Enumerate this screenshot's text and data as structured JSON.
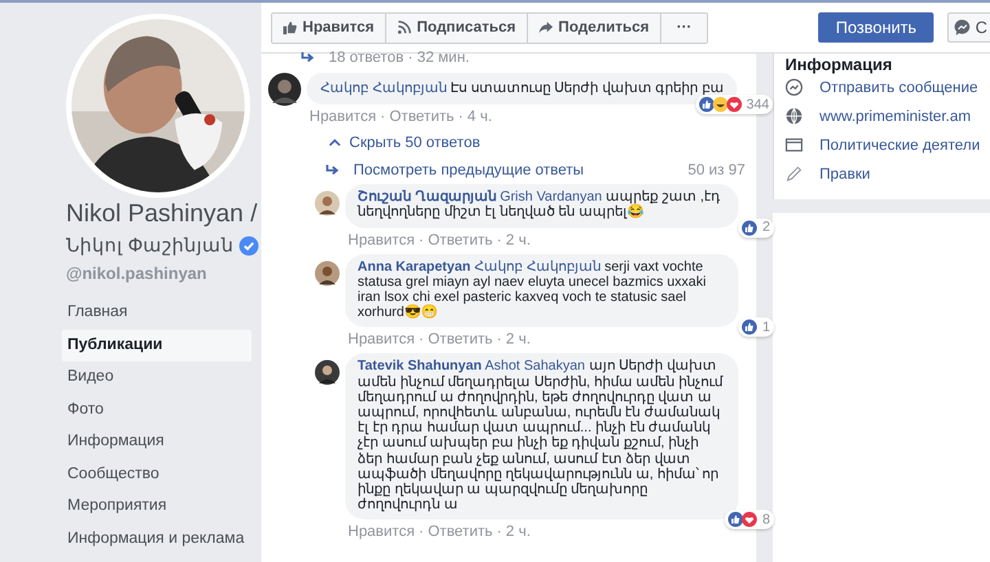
{
  "profile": {
    "name_line1": "Nikol Pashinyan /",
    "name_line2": "Նիկոլ Փաշինյան",
    "verified": true,
    "handle": "@nikol.pashinyan"
  },
  "nav": [
    {
      "label": "Главная",
      "selected": false
    },
    {
      "label": "Публикации",
      "selected": true
    },
    {
      "label": "Видео",
      "selected": false
    },
    {
      "label": "Фото",
      "selected": false
    },
    {
      "label": "Информация",
      "selected": false
    },
    {
      "label": "Сообщество",
      "selected": false
    },
    {
      "label": "Мероприятия",
      "selected": false
    },
    {
      "label": "Информация и реклама",
      "selected": false
    }
  ],
  "page_actions": [
    {
      "kind": "like",
      "label": "Нравится"
    },
    {
      "kind": "follow",
      "label": "Подписаться"
    },
    {
      "kind": "share",
      "label": "Поделиться"
    },
    {
      "kind": "more",
      "label": "···"
    }
  ],
  "call_button": "Позвонить",
  "message_button": "С",
  "thread": {
    "replies_summary": "18 ответов · 32 мин.",
    "comment": {
      "author": "Հակոբ Հակոբյան",
      "text": "Էս ստատուսը Սերժի վախտ գրեիր բա",
      "reactions": [
        {
          "kind": "like"
        },
        {
          "kind": "haha"
        },
        {
          "kind": "love"
        }
      ],
      "reaction_count": "344",
      "like": "Нравится",
      "separator": "·",
      "reply": "Ответить",
      "time": "4 ч."
    },
    "hide_replies": "Скрыть 50 ответов",
    "previous_replies": "Посмотреть предыдущие ответы",
    "shown_count": "50 из 97",
    "replies": [
      {
        "author": "Շուշան Ղազարյան",
        "tag": "Grish Vardanyan",
        "text": "ապրեք շատ ,էդ նեղվողները միշտ էլ նեղված են ապրել😂",
        "reactions": [
          {
            "kind": "like"
          }
        ],
        "reaction_count": "2",
        "like": "Нравится",
        "separator": "·",
        "reply": "Ответить",
        "time": "2 ч."
      },
      {
        "author": "Anna Karapetyan",
        "tag": "Հակոբ Հակոբյան",
        "text": "serji vaxt vochte statusa grel miayn ayl naev eluyta unecel bazmics uxxaki iran lsox chi exel pasteric kaxveq voch te statusic sael xorhurd😎😁",
        "reactions": [
          {
            "kind": "like"
          }
        ],
        "reaction_count": "1",
        "like": "Нравится",
        "separator": "·",
        "reply": "Ответить",
        "time": "2 ч."
      },
      {
        "author": "Tatevik Shahunyan",
        "tag": "Ashot Sahakyan",
        "text": "այո Սերժի վախտ ամեն ինչում մեղադրելա Սերժին, հիմա ամեն ինչում մեղադրում ա ժողովրդին, եթե ժողովուրդը վատ ա ապրում, որովհետև անբանա, ուրեմն էն ժամանակ էլ էր դրա համար վատ ապրում... ինչի էն ժամանկ չէր ասում ախպեր բա ինչի եք դիվան քշում, ինչի ձեր համար բան չեք անում, ասում էտ ձեր վատ ապֆածի մեղավորը ղեկավարությունն ա, հիմա՝ որ ինքը ղեկավար ա պարզվումը մեղախորը ժողովուրդն ա",
        "reactions": [
          {
            "kind": "like"
          },
          {
            "kind": "love"
          }
        ],
        "reaction_count": "8",
        "like": "Нравится",
        "separator": "·",
        "reply": "Ответить",
        "time": "2 ч."
      }
    ]
  },
  "info": {
    "title": "Информация",
    "items": [
      {
        "kind": "messenger",
        "label": "Отправить сообщение"
      },
      {
        "kind": "globe",
        "label": "www.primeminister.am"
      },
      {
        "kind": "category",
        "label": "Политические деятели"
      },
      {
        "kind": "edit",
        "label": "Правки"
      }
    ]
  }
}
